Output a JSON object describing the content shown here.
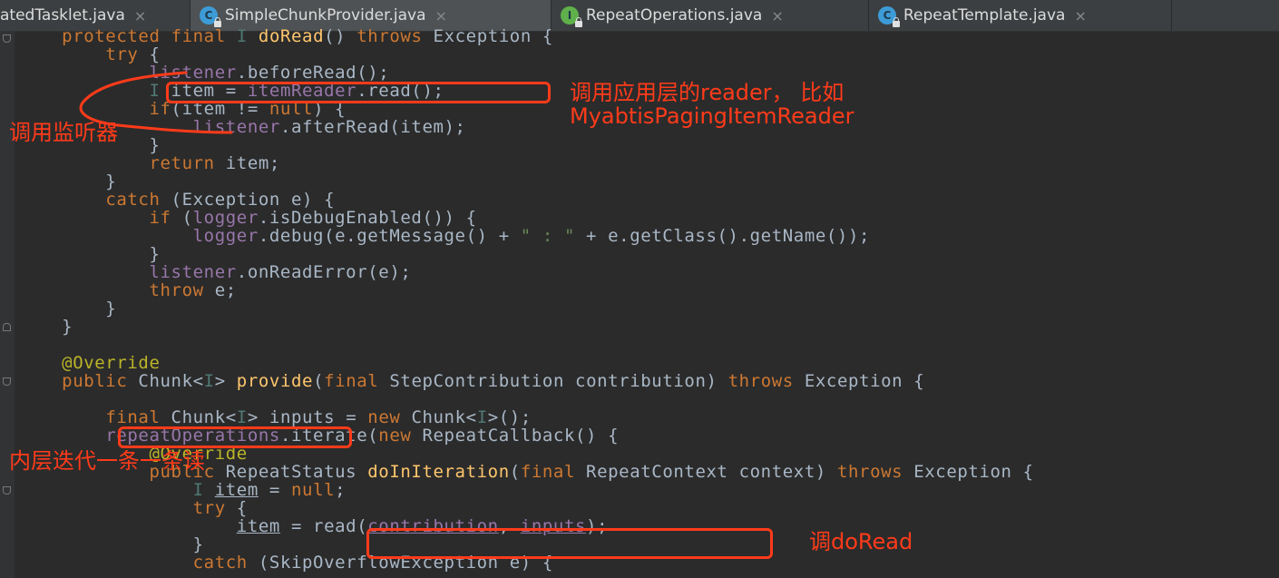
{
  "tabs": [
    {
      "label": "atedTasklet.java",
      "icon": "",
      "active": false
    },
    {
      "label": "SimpleChunkProvider.java",
      "icon": "class-icon",
      "badge": "C",
      "active": true
    },
    {
      "label": "RepeatOperations.java",
      "icon": "interface-icon",
      "badge": "I",
      "active": false
    },
    {
      "label": "RepeatTemplate.java",
      "icon": "class-icon",
      "badge": "C",
      "active": false
    }
  ],
  "close_glyph": "×",
  "code": {
    "l1": [
      "    ",
      "protected",
      " ",
      "final",
      " ",
      "I",
      " ",
      "doRead",
      "() ",
      "throws",
      " Exception {"
    ],
    "l2": [
      "        ",
      "try",
      " {"
    ],
    "l3": [
      "            ",
      "listener",
      ".beforeRead();"
    ],
    "l4": [
      "            ",
      "I",
      " item = ",
      "itemReader",
      ".read();"
    ],
    "l5": [
      "            ",
      "if",
      "(item != ",
      "null",
      ") {"
    ],
    "l6": [
      "                ",
      "listener",
      ".afterRead(item);"
    ],
    "l7": [
      "            }"
    ],
    "l8": [
      "            ",
      "return",
      " item;"
    ],
    "l9": [
      "        }"
    ],
    "l10": [
      "        ",
      "catch",
      " (Exception e) {"
    ],
    "l11": [
      "            ",
      "if",
      " (",
      "logger",
      ".isDebugEnabled()) {"
    ],
    "l12": [
      "                ",
      "logger",
      ".debug(e.getMessage() + ",
      "\" : \"",
      " + e.getClass().getName());"
    ],
    "l13": [
      "            }"
    ],
    "l14": [
      "            ",
      "listener",
      ".onReadError(e);"
    ],
    "l15": [
      "            ",
      "throw",
      " e;"
    ],
    "l16": [
      "        }"
    ],
    "l17": [
      "    }"
    ],
    "l18": [
      ""
    ],
    "l19": [
      "    ",
      "@Override"
    ],
    "l20": [
      "    ",
      "public",
      " Chunk<",
      "I",
      "> ",
      "provide",
      "(",
      "final",
      " StepContribution contribution) ",
      "throws",
      " Exception {"
    ],
    "l21": [
      ""
    ],
    "l22": [
      "        ",
      "final",
      " Chunk<",
      "I",
      "> inputs = ",
      "new",
      " Chunk<",
      "I",
      ">();"
    ],
    "l23": [
      "        ",
      "repeatOperations",
      ".iterate(",
      "new",
      " RepeatCallback() {"
    ],
    "l24": [
      "            ",
      "@Override"
    ],
    "l25": [
      "            ",
      "public",
      " RepeatStatus ",
      "doInIteration",
      "(",
      "final",
      " RepeatContext context) ",
      "throws",
      " Exception {"
    ],
    "l26": [
      "                ",
      "I",
      " ",
      "item",
      " = ",
      "null",
      ";"
    ],
    "l27": [
      "                ",
      "try",
      " {"
    ],
    "l28": [
      "                    ",
      "item",
      " = read(",
      "contribution",
      ", ",
      "inputs",
      ");"
    ],
    "l29": [
      "                }"
    ],
    "l30": [
      "                ",
      "catch",
      " (SkipOverflowException e) {"
    ]
  },
  "annotations": {
    "reader_note_1": "调用应用层的reader， 比如",
    "reader_note_2": "MyabtisPagingItemReader",
    "listener_note": "调用监听器",
    "inner_note": "内层迭代一条一条读",
    "doread_note": "调doRead"
  },
  "colors": {
    "background": "#2b2b2b",
    "keyword": "#cc7832",
    "method": "#ffc66d",
    "field": "#9876aa",
    "type_param": "#507874",
    "string": "#6a8759",
    "annotation": "#bbb529",
    "annotation_red": "#ff3b1a"
  }
}
